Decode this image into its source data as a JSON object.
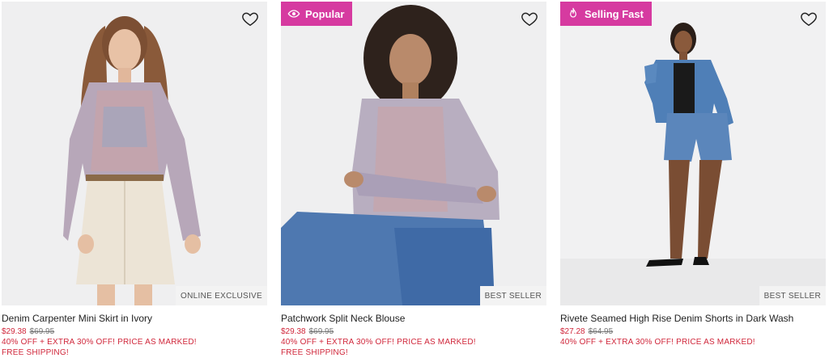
{
  "products": [
    {
      "title": "Denim Carpenter Mini Skirt in Ivory",
      "sale_price": "$29.38",
      "original_price": "$69.95",
      "promo": "40% OFF + EXTRA 30% OFF! PRICE AS MARKED!",
      "shipping": "FREE SHIPPING!",
      "corner_tag": "ONLINE EXCLUSIVE",
      "badge": ""
    },
    {
      "title": "Patchwork Split Neck Blouse",
      "sale_price": "$29.38",
      "original_price": "$69.95",
      "promo": "40% OFF + EXTRA 30% OFF! PRICE AS MARKED!",
      "shipping": "FREE SHIPPING!",
      "corner_tag": "BEST SELLER",
      "badge": "Popular",
      "badge_icon": "eye-icon"
    },
    {
      "title": "Rivete Seamed High Rise Denim Shorts in Dark Wash",
      "sale_price": "$27.28",
      "original_price": "$64.95",
      "promo": "40% OFF + EXTRA 30% OFF! PRICE AS MARKED!",
      "shipping": "",
      "corner_tag": "BEST SELLER",
      "badge": "Selling Fast",
      "badge_icon": "flame-icon"
    }
  ],
  "colors": {
    "badge": "#d63aa0",
    "sale": "#d0273b"
  }
}
